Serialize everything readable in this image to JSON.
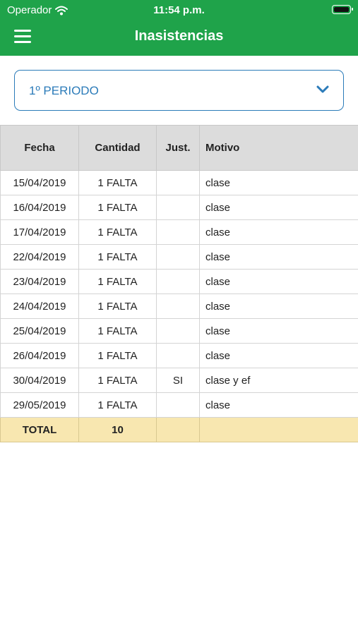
{
  "status_bar": {
    "carrier": "Operador",
    "time": "11:54 p.m."
  },
  "header": {
    "title": "Inasistencias"
  },
  "period_select": {
    "value": "1º PERIODO"
  },
  "table": {
    "columns": [
      "Fecha",
      "Cantidad",
      "Just.",
      "Motivo"
    ],
    "rows": [
      [
        "15/04/2019",
        "1 FALTA",
        "",
        "clase"
      ],
      [
        "16/04/2019",
        "1 FALTA",
        "",
        "clase"
      ],
      [
        "17/04/2019",
        "1 FALTA",
        "",
        "clase"
      ],
      [
        "22/04/2019",
        "1 FALTA",
        "",
        "clase"
      ],
      [
        "23/04/2019",
        "1 FALTA",
        "",
        "clase"
      ],
      [
        "24/04/2019",
        "1 FALTA",
        "",
        "clase"
      ],
      [
        "25/04/2019",
        "1 FALTA",
        "",
        "clase"
      ],
      [
        "26/04/2019",
        "1 FALTA",
        "",
        "clase"
      ],
      [
        "30/04/2019",
        "1 FALTA",
        "SI",
        "clase y ef"
      ],
      [
        "29/05/2019",
        "1 FALTA",
        "",
        "clase"
      ]
    ],
    "total": {
      "label": "TOTAL",
      "count": "10"
    }
  },
  "colors": {
    "header_bg": "#1fa34a",
    "accent": "#2b7bb9",
    "total_bg": "#f8e7b0"
  },
  "icons": [
    "menu-icon",
    "wifi-icon",
    "battery-icon",
    "chevron-down-icon"
  ]
}
